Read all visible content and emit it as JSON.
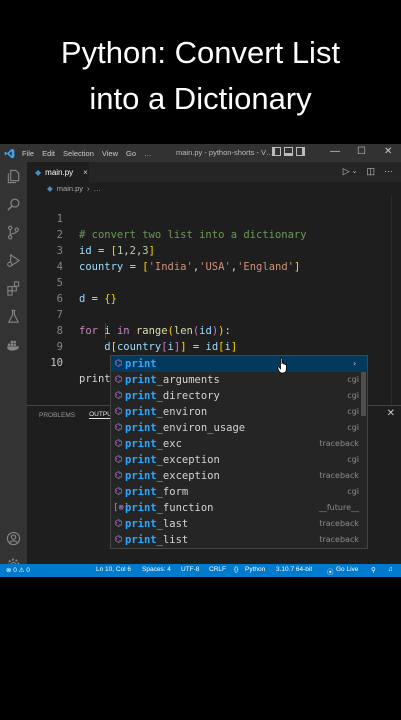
{
  "caption": {
    "line1": "Python: Convert List",
    "line2": "into a Dictionary"
  },
  "titlebar": {
    "menus": [
      "File",
      "Edit",
      "Selection",
      "View",
      "Go",
      "…"
    ],
    "title": "main.py - python-shorts - V…",
    "min": "—",
    "max": "☐",
    "close": "✕"
  },
  "tab": {
    "name": "main.py",
    "close": "×"
  },
  "breadcrumb": {
    "file": "main.py",
    "more": "…"
  },
  "editor": {
    "line_numbers": [
      "1",
      "2",
      "3",
      "4",
      "5",
      "6",
      "7",
      "8",
      "9",
      "10"
    ],
    "current_input": "print"
  },
  "panel": {
    "tabs": [
      "PROBLEMS",
      "OUTPUT"
    ]
  },
  "suggestions": [
    {
      "match": "print",
      "rest": "",
      "detail": "",
      "icon": "module-icon",
      "glyph": "⌬"
    },
    {
      "match": "print",
      "rest": "_arguments",
      "detail": "cgi",
      "icon": "module-icon",
      "glyph": "⌬"
    },
    {
      "match": "print",
      "rest": "_directory",
      "detail": "cgi",
      "icon": "module-icon",
      "glyph": "⌬"
    },
    {
      "match": "print",
      "rest": "_environ",
      "detail": "cgi",
      "icon": "module-icon",
      "glyph": "⌬"
    },
    {
      "match": "print",
      "rest": "_environ_usage",
      "detail": "cgi",
      "icon": "module-icon",
      "glyph": "⌬"
    },
    {
      "match": "print",
      "rest": "_exc",
      "detail": "traceback",
      "icon": "module-icon",
      "glyph": "⌬"
    },
    {
      "match": "print",
      "rest": "_exception",
      "detail": "cgi",
      "icon": "module-icon",
      "glyph": "⌬"
    },
    {
      "match": "print",
      "rest": "_exception",
      "detail": "traceback",
      "icon": "module-icon",
      "glyph": "⌬"
    },
    {
      "match": "print",
      "rest": "_form",
      "detail": "cgi",
      "icon": "module-icon",
      "glyph": "⌬"
    },
    {
      "match": "print",
      "rest": "_function",
      "detail": "__future__",
      "icon": "variable-icon",
      "glyph": "[⊗]"
    },
    {
      "match": "print",
      "rest": "_last",
      "detail": "traceback",
      "icon": "module-icon",
      "glyph": "⌬"
    },
    {
      "match": "print",
      "rest": "_list",
      "detail": "traceback",
      "icon": "module-icon",
      "glyph": "⌬"
    }
  ],
  "statusbar": {
    "problems": "⊗ 0 ⚠ 0",
    "position": "Ln 10, Col 6",
    "spaces": "Spaces: 4",
    "encoding": "UTF-8",
    "eol": "CRLF",
    "language": "Python",
    "interpreter": "3.10.7 64-bit",
    "golive": "Go Live"
  },
  "colors": {
    "accent": "#007acc",
    "selection": "#04395e",
    "match": "#2aaaff"
  }
}
